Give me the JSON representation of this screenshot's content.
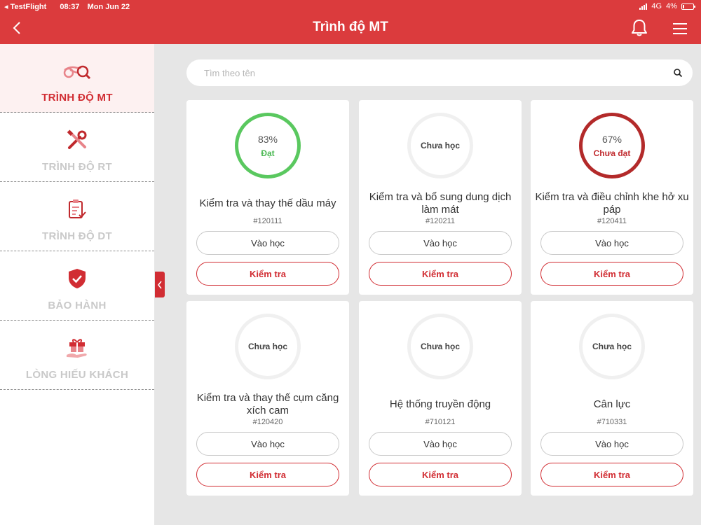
{
  "status_bar": {
    "app": "TestFlight",
    "time": "08:37",
    "date": "Mon Jun 22",
    "network": "4G",
    "battery": "4%"
  },
  "header": {
    "title": "Trình độ MT"
  },
  "sidebar": {
    "items": [
      {
        "label": "TRÌNH ĐỘ MT",
        "icon": "motorbike-search-icon",
        "active": true
      },
      {
        "label": "TRÌNH ĐỘ RT",
        "icon": "wrench-screwdriver-icon",
        "active": false
      },
      {
        "label": "TRÌNH ĐỘ DT",
        "icon": "clipboard-check-icon",
        "active": false
      },
      {
        "label": "BẢO HÀNH",
        "icon": "shield-check-icon",
        "active": false
      },
      {
        "label": "LÒNG HIẾU KHÁCH",
        "icon": "gift-hand-icon",
        "active": false
      }
    ]
  },
  "search": {
    "placeholder": "Tìm theo tên",
    "value": ""
  },
  "buttons": {
    "learn": "Vào học",
    "test": "Kiểm tra"
  },
  "courses": [
    {
      "title": "Kiểm tra và thay thế dầu máy",
      "code": "#120111",
      "percent": "83%",
      "status": "Đạt",
      "state": "pass"
    },
    {
      "title": "Kiểm tra và bổ sung dung dịch làm mát",
      "code": "#120211",
      "status": "Chưa học",
      "state": "none"
    },
    {
      "title": "Kiểm tra và điều chỉnh khe hở xu páp",
      "code": "#120411",
      "percent": "67%",
      "status": "Chưa đạt",
      "state": "fail"
    },
    {
      "title": "Kiểm tra và thay thế cụm căng xích cam",
      "code": "#120420",
      "status": "Chưa học",
      "state": "none"
    },
    {
      "title": "Hệ thống truyền động",
      "code": "#710121",
      "status": "Chưa học",
      "state": "none"
    },
    {
      "title": "Cân lực",
      "code": "#710331",
      "status": "Chưa học",
      "state": "none"
    }
  ],
  "colors": {
    "brand": "#db3b3d",
    "accent": "#d12d33",
    "pass": "#5ac85f",
    "fail": "#b32a2a"
  }
}
